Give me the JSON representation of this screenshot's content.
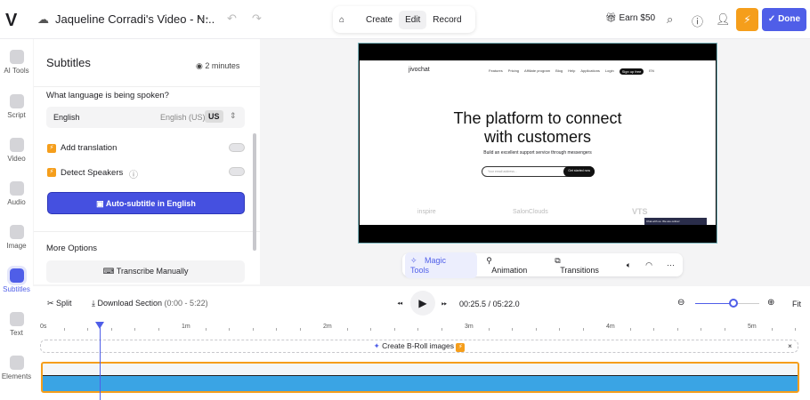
{
  "header": {
    "logo": "V",
    "title": "Jaqueline Corradi's Video - N...",
    "more": "···",
    "undo": "↶",
    "redo": "↷",
    "modes": [
      "Create",
      "Edit",
      "Record"
    ],
    "active_mode": "Edit",
    "earn": "Earn $50",
    "done": "Done"
  },
  "rail": [
    {
      "label": "AI Tools"
    },
    {
      "label": "Script"
    },
    {
      "label": "Video"
    },
    {
      "label": "Audio"
    },
    {
      "label": "Image"
    },
    {
      "label": "Subtitles",
      "active": true
    },
    {
      "label": "Text"
    },
    {
      "label": "Elements"
    }
  ],
  "panel": {
    "title": "Subtitles",
    "duration": "2 minutes",
    "question": "What language is being spoken?",
    "language": "English",
    "locale": "English (US)",
    "locale_code": "US",
    "add_translation": "Add translation",
    "add_translation_on": false,
    "detect_speakers": "Detect Speakers",
    "detect_speakers_on": false,
    "auto_button": "Auto-subtitle in English",
    "more_options": "More Options",
    "transcribe": "Transcribe Manually"
  },
  "preview": {
    "site_logo": "jivochat",
    "nav": [
      "Features",
      "Pricing",
      "Affiliate program",
      "Blog",
      "Help",
      "Applications",
      "Login"
    ],
    "signup": "Sign up free",
    "lang": "EN",
    "headline1": "The platform to connect",
    "headline2": "with customers",
    "sub": "Build an excellent support service through messengers",
    "email_placeholder": "Your email address...",
    "cta": "Get started now",
    "logos": [
      "inspire",
      "SalonClouds",
      "VTS"
    ],
    "chat": "Chat with us. We are online!"
  },
  "toolbar": {
    "magic": "Magic Tools",
    "animation": "Animation",
    "transitions": "Transitions",
    "more": "···"
  },
  "timeline": {
    "split": "Split",
    "download": "Download Section",
    "range": "(0:00 - 5:22)",
    "current": "00:25.5",
    "sep": "/",
    "total": "05:22.0",
    "fit": "Fit",
    "zoom_level": 0.6,
    "ruler": [
      "0s",
      "1m",
      "2m",
      "3m",
      "4m",
      "5m"
    ],
    "broll": "Create B-Roll images",
    "close": "×"
  },
  "colors": {
    "accent": "#4f5ee8",
    "orange": "#f59e1b",
    "waveform": "#3aa4e4"
  }
}
